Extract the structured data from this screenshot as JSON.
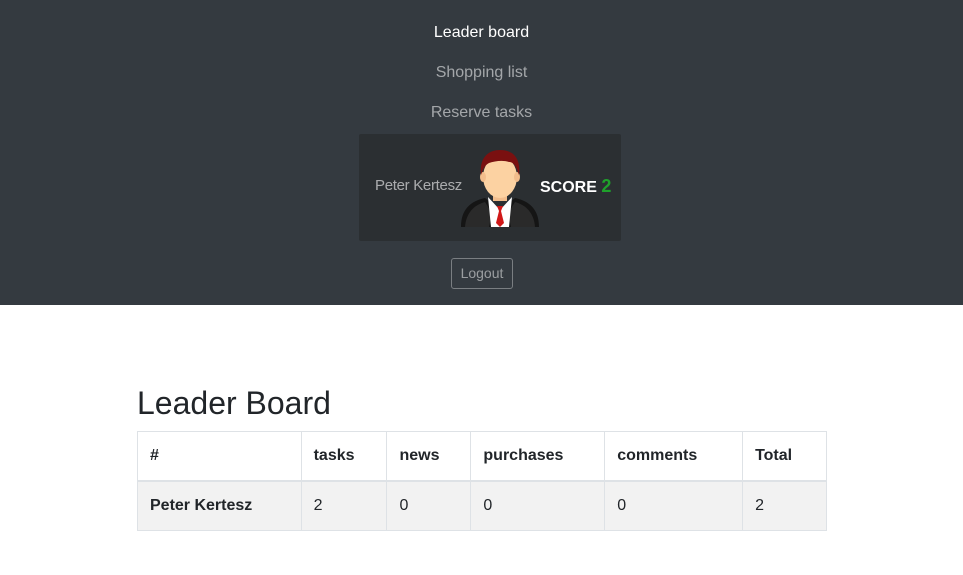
{
  "nav": {
    "items": [
      {
        "label": "Leader board",
        "active": true
      },
      {
        "label": "Shopping list",
        "active": false
      },
      {
        "label": "Reserve tasks",
        "active": false
      }
    ]
  },
  "user": {
    "name": "Peter Kertesz",
    "avatar_icon": "businessman-avatar-icon",
    "score_label": "SCORE",
    "score_value": "2"
  },
  "logout_label": "Logout",
  "main": {
    "title": "Leader Board",
    "table": {
      "headers": [
        "#",
        "tasks",
        "news",
        "purchases",
        "comments",
        "Total"
      ],
      "rows": [
        [
          "Peter Kertesz",
          "2",
          "0",
          "0",
          "0",
          "2"
        ]
      ]
    }
  },
  "colors": {
    "navbar_bg": "#343a40",
    "card_bg": "#2b2f32",
    "score_green": "#1fa12b",
    "row_bg": "#f2f2f2"
  }
}
